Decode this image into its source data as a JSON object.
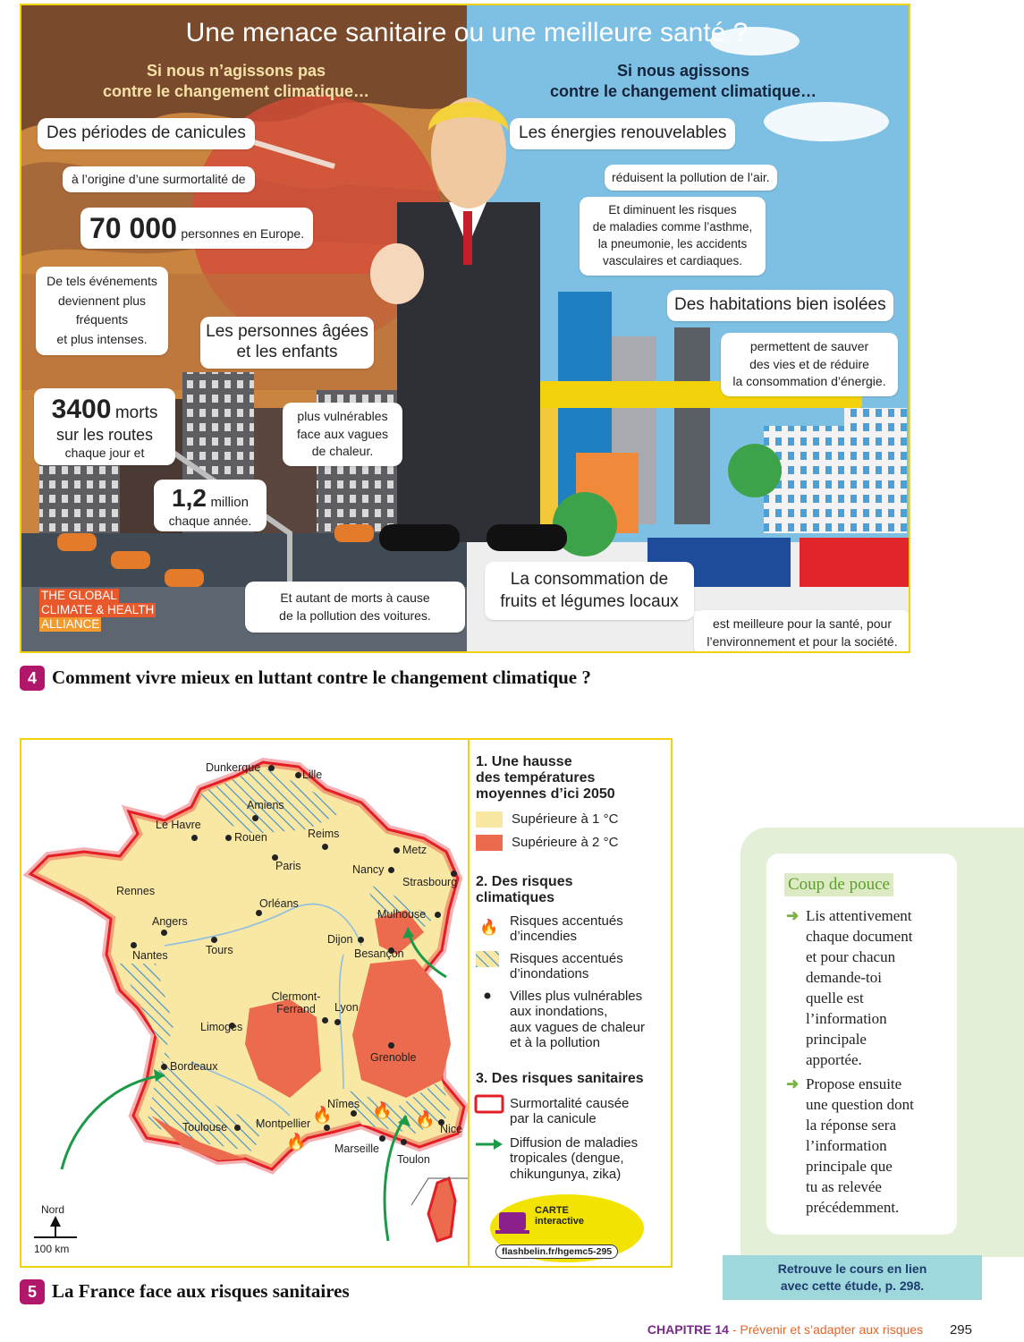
{
  "infographic": {
    "title": "Une menace sanitaire ou une meilleure santé ?",
    "left_subtitle": [
      "Si nous n’agissons pas",
      "contre le changement climatique…"
    ],
    "right_subtitle": [
      "Si nous agissons",
      "contre le changement climatique…"
    ],
    "canicules": "Des périodes de canicules",
    "surmortalite": "à l’origine d’une surmortalité de",
    "big_number": "70 000",
    "big_number_suffix": "personnes en Europe.",
    "events": [
      "De tels événements",
      "deviennent plus",
      "fréquents",
      "et plus intenses."
    ],
    "agees": [
      "Les personnes âgées",
      "et les enfants"
    ],
    "vulnerables": [
      "plus vulnérables",
      "face aux vagues",
      "de chaleur."
    ],
    "morts_number": "3400",
    "morts_word": "morts",
    "morts_routes": "sur les routes",
    "morts_jour": "chaque jour et",
    "million_number": "1,2",
    "million_word": "million",
    "million_annee": "chaque année.",
    "pollution": [
      "Et autant de morts à cause",
      "de la pollution des voitures."
    ],
    "source": [
      "THE GLOBAL",
      "CLIMATE & HEALTH",
      "ALLIANCE"
    ],
    "energies": "Les énergies renouvelables",
    "reduisent": "réduisent la pollution de l’air.",
    "diminuent": [
      "Et diminuent les risques",
      "de maladies comme l’asthme,",
      "la pneumonie, les accidents",
      "vasculaires et cardiaques."
    ],
    "habitations": "Des habitations bien isolées",
    "permettent": [
      "permettent de sauver",
      "des vies et de réduire",
      "la consommation d’énergie."
    ],
    "consommation": [
      "La consommation de",
      "fruits et légumes locaux"
    ],
    "meilleure": [
      "est meilleure pour la santé, pour",
      "l’environnement et pour la société."
    ]
  },
  "caption4": {
    "number": "4",
    "text": "Comment vivre mieux en luttant contre le changement climatique ?"
  },
  "caption5": {
    "number": "5",
    "text": "La France face aux risques sanitaires"
  },
  "map": {
    "cities": [
      "Dunkerque",
      "Lille",
      "Amiens",
      "Le Havre",
      "Rouen",
      "Reims",
      "Metz",
      "Paris",
      "Nancy",
      "Strasbourg",
      "Rennes",
      "Orléans",
      "Mulhouse",
      "Angers",
      "Dijon",
      "Nantes",
      "Tours",
      "Besançon",
      "Clermont-Ferrand",
      "Lyon",
      "Limoges",
      "Grenoble",
      "Bordeaux",
      "Nîmes",
      "Toulouse",
      "Montpellier",
      "Nice",
      "Marseille",
      "Toulon"
    ],
    "north": "Nord",
    "scale": "100 km",
    "carte_label": "CARTE",
    "carte_sub": "interactive",
    "carte_url": "flashbelin.fr/hgemc5-295"
  },
  "legend": {
    "s1_title": [
      "1. Une hausse",
      "des températures",
      "moyennes d’ici 2050"
    ],
    "s1_items": [
      "Supérieure à 1 °C",
      "Supérieure à 2 °C"
    ],
    "s2_title": [
      "2. Des risques",
      "climatiques"
    ],
    "s2_items": [
      [
        "Risques accentués",
        "d’incendies"
      ],
      [
        "Risques accentués",
        "d’inondations"
      ],
      [
        "Villes plus vulnérables",
        "aux inondations,",
        "aux vagues de chaleur",
        "et à la pollution"
      ]
    ],
    "s3_title": "3. Des risques sanitaires",
    "s3_items": [
      [
        "Surmortalité causée",
        "par la canicule"
      ],
      [
        "Diffusion de maladies",
        "tropicales (dengue,",
        "chikungunya, zika)"
      ]
    ],
    "colors": {
      "temp1": "#f9e7a4",
      "temp2": "#ec6a4e",
      "canicule": "#e31e24",
      "disease": "#1c9a48"
    }
  },
  "pouce": {
    "title": "Coup de pouce",
    "items": [
      [
        "Lis attentivement",
        "chaque document",
        "et pour chacun",
        "demande-toi",
        "quelle est",
        "l’information",
        "principale",
        "apportée."
      ],
      [
        "Propose ensuite",
        "une question dont",
        "la réponse sera",
        "l’information",
        "principale que",
        "tu as relevée",
        "précédemment."
      ]
    ],
    "ribbon": [
      "Retrouve le cours en lien",
      "avec cette étude, p. 298."
    ]
  },
  "footer": {
    "chapter": "CHAPITRE 14",
    "dash": " - ",
    "title": "Prévenir et s’adapter aux risques",
    "page": "295"
  }
}
